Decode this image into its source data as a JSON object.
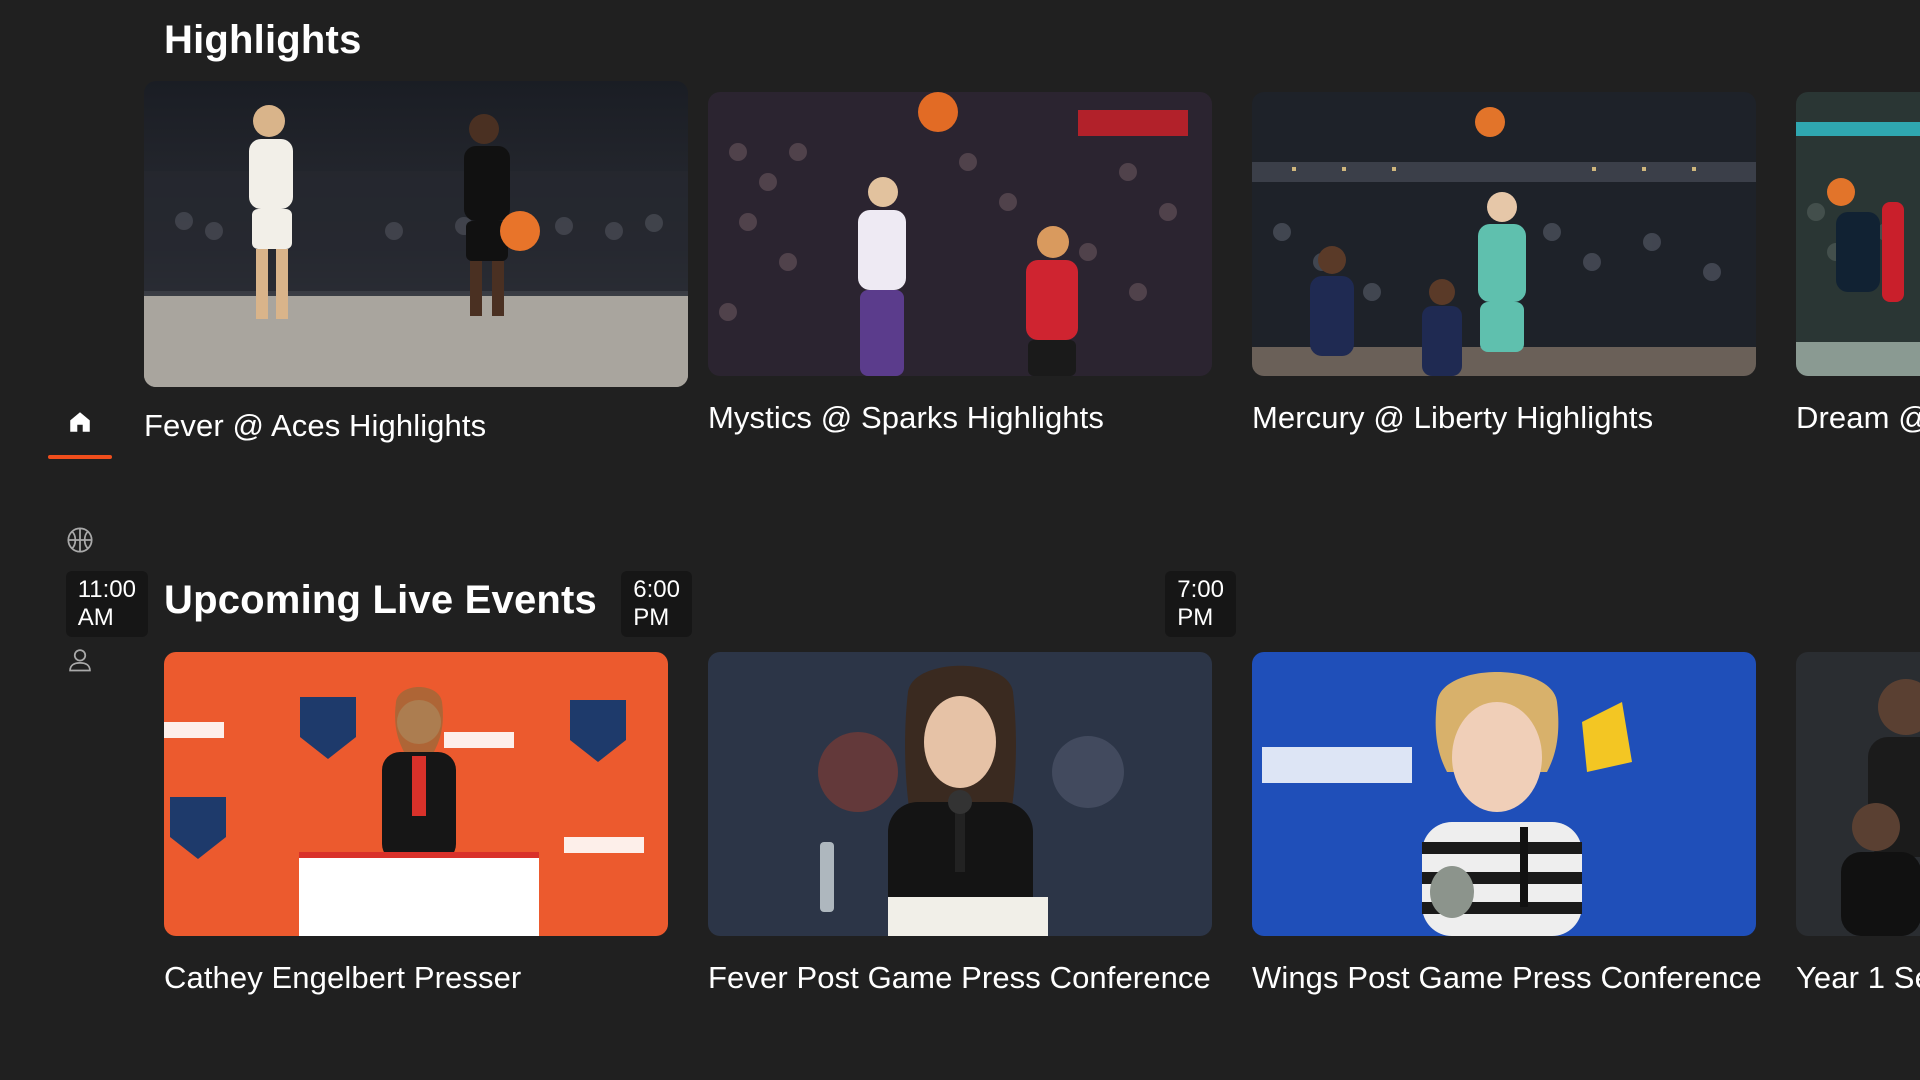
{
  "theme": {
    "accent": "#F04E1C",
    "background": "#202020",
    "text": "#FFFFFF",
    "icon_muted": "#A9A9A9"
  },
  "sidebar": {
    "items": [
      {
        "icon": "home-icon",
        "selected": true
      },
      {
        "icon": "basketball-icon",
        "selected": false
      },
      {
        "icon": "profile-icon",
        "selected": false
      }
    ]
  },
  "highlights": {
    "title": "Highlights",
    "cards": [
      {
        "title": "Fever @ Aces Highlights",
        "focused": true
      },
      {
        "title": "Mystics @ Sparks Highlights"
      },
      {
        "title": "Mercury @ Liberty Highlights"
      },
      {
        "title": "Dream @"
      }
    ]
  },
  "upcoming": {
    "title": "Upcoming Live Events",
    "cards": [
      {
        "title": "Cathey Engelbert Presser",
        "time": "11:00 AM"
      },
      {
        "title": "Fever Post Game Press Conference",
        "time": "6:00 PM"
      },
      {
        "title": "Wings Post Game Press Conference",
        "time": "7:00 PM"
      },
      {
        "title": "Year 1 Se",
        "time": ""
      }
    ]
  }
}
